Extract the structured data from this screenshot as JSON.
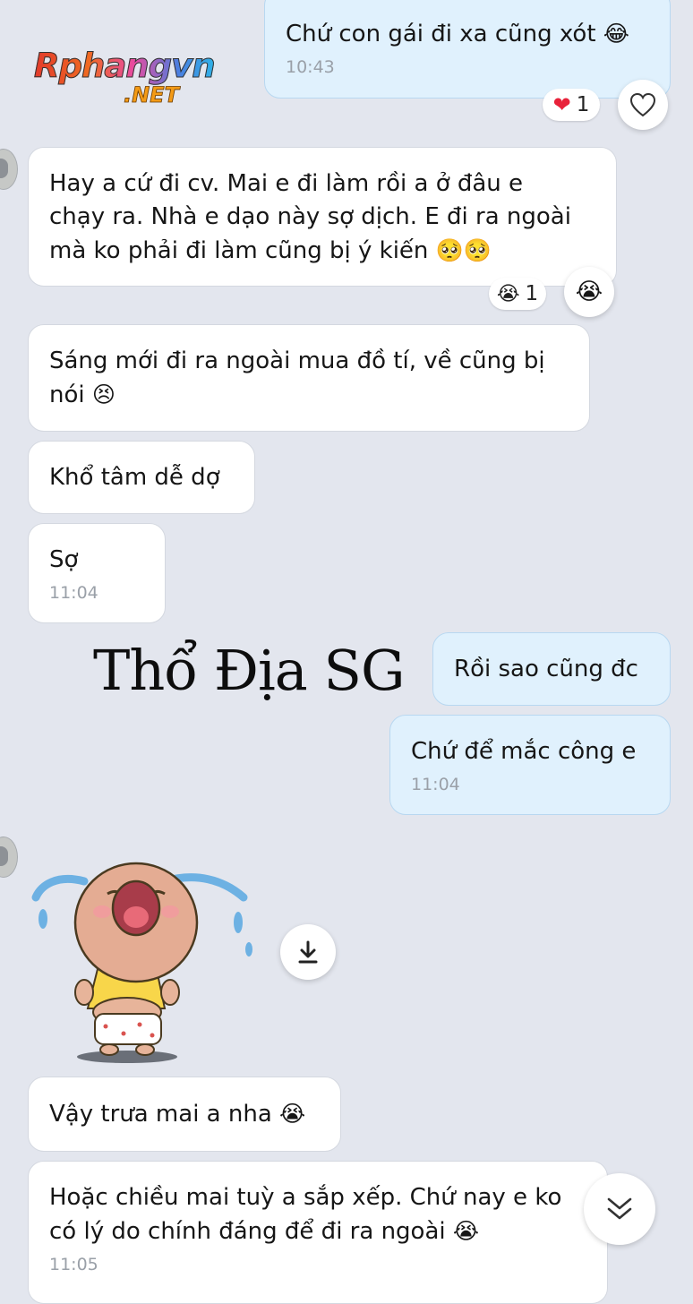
{
  "logo": {
    "main": "Rphangvn",
    "sub": ".NET"
  },
  "watermark": "Thổ Địa SG",
  "messages": {
    "m1": {
      "text": "Chứ con gái đi xa cũng xót",
      "emoji": "😂",
      "time": "10:43",
      "reaction_emoji": "❤",
      "reaction_count": "1"
    },
    "m2": {
      "line1": "Hay a cứ đi cv. Mai e đi làm rồi a ở đâu e",
      "line2": "chạy ra. Nhà e dạo này sợ dịch. E đi ra ngoài",
      "line3": "mà ko phải đi làm cũng bị ý kiến",
      "emoji": "🥺🥺",
      "reaction_emoji": "😭",
      "reaction_count": "1",
      "react_button_emoji": "😭"
    },
    "m3": {
      "line1": "Sáng mới đi ra ngoài mua đồ tí, về cũng bị",
      "line2": "nói",
      "emoji": "😣"
    },
    "m4": {
      "text": "Khổ tâm dễ dợ"
    },
    "m5": {
      "text": "Sợ",
      "time": "11:04"
    },
    "m6": {
      "text": "Rồi sao cũng đc"
    },
    "m7": {
      "text": "Chứ để mắc công e",
      "time": "11:04"
    },
    "m8": {
      "text": "Vậy trưa mai a nha",
      "emoji": "😭"
    },
    "m9": {
      "line1": "Hoặc chiều mai tuỳ a sắp xếp. Chứ nay e ko",
      "line2": "có lý do chính đáng để đi ra ngoài",
      "emoji": "😭",
      "time": "11:05"
    }
  },
  "colors": {
    "background": "#e3e6ee",
    "incoming_bubble": "#ffffff",
    "outgoing_bubble": "#e0f1fd",
    "heart": "#e8223a"
  },
  "icons": {
    "like": "heart-outline-icon",
    "download": "download-icon",
    "scroll": "double-chevron-down-icon"
  }
}
